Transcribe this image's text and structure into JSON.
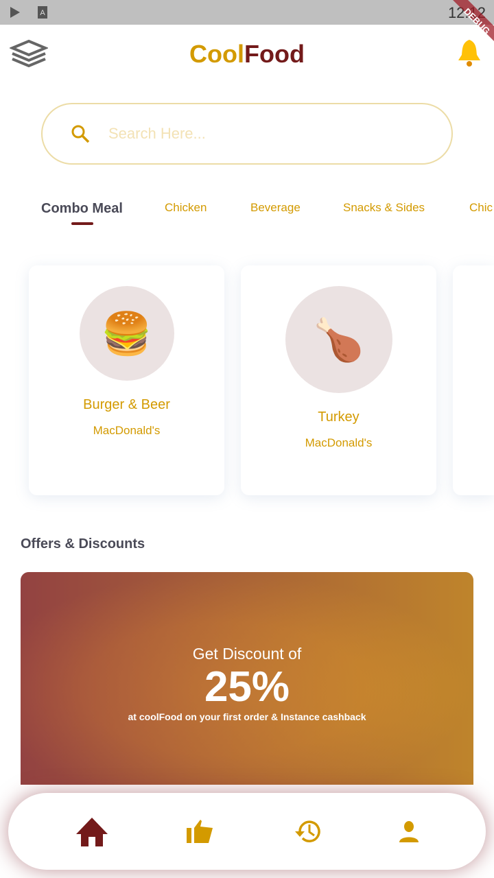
{
  "status": {
    "time": "12:12",
    "debug": "DEBUG"
  },
  "header": {
    "title_part1": "Cool",
    "title_part2": "Food"
  },
  "search": {
    "placeholder": "Search Here..."
  },
  "tabs": [
    "Combo Meal",
    "Chicken",
    "Beverage",
    "Snacks & Sides",
    "Chic"
  ],
  "cards": [
    {
      "name": "Burger & Beer",
      "brand": "MacDonald's",
      "emoji": "🍔"
    },
    {
      "name": "Turkey",
      "brand": "MacDonald's",
      "emoji": "🍗"
    }
  ],
  "offers": {
    "title": "Offers & Discounts",
    "line1": "Get Discount of",
    "percent": "25%",
    "line2": "at coolFood on your first order & Instance cashback"
  },
  "colors": {
    "gold": "#d39a00",
    "maroon": "#731a1a",
    "bell": "#ffc107"
  },
  "nav": [
    "home-icon",
    "thumbs-up-icon",
    "history-icon",
    "person-icon"
  ]
}
